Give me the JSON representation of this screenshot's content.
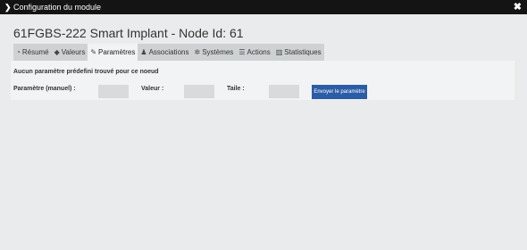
{
  "window": {
    "title": "Configuration du module",
    "close_symbol": "✖"
  },
  "page": {
    "title": "61FGBS-222 Smart Implant - Node Id: 61"
  },
  "tabs": [
    {
      "label": "Résumé",
      "icon": "tachometer-icon",
      "glyph": "◔",
      "active": false
    },
    {
      "label": "Valeurs",
      "icon": "tag-icon",
      "glyph": "◆",
      "active": false
    },
    {
      "label": "Paramètres",
      "icon": "wrench-icon",
      "glyph": "✎",
      "active": true
    },
    {
      "label": "Associations",
      "icon": "users-icon",
      "glyph": "♟",
      "active": false
    },
    {
      "label": "Systèmes",
      "icon": "cogs-icon",
      "glyph": "✲",
      "active": false
    },
    {
      "label": "Actions",
      "icon": "list-icon",
      "glyph": "☰",
      "active": false
    },
    {
      "label": "Statistiques",
      "icon": "chart-icon",
      "glyph": "▥",
      "active": false
    }
  ],
  "parameters": {
    "notice": "Aucun paramètre prédefini trouvé pour ce noeud",
    "param_label": "Paramètre (manuel) :",
    "param_value": "",
    "value_label": "Valeur :",
    "value_value": "",
    "size_label": "Taile :",
    "size_value": "",
    "send_button": "Envoyer le paramètre"
  }
}
